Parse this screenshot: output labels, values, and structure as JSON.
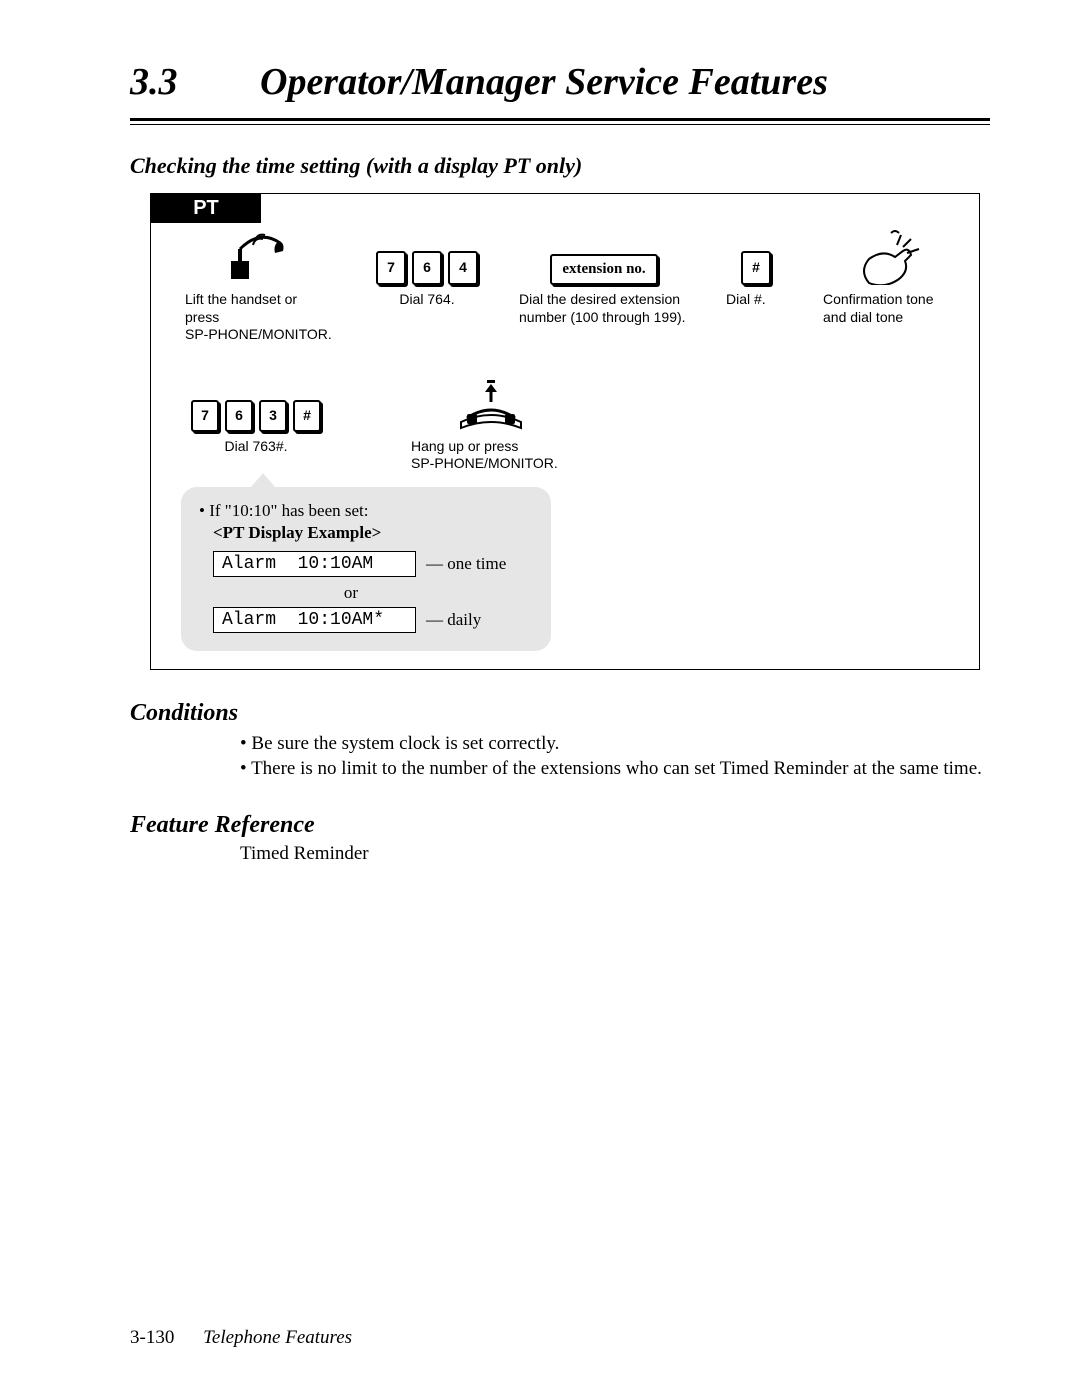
{
  "header": {
    "num": "3.3",
    "title": "Operator/Manager Service Features"
  },
  "subheading": "Checking the time setting (with a display PT only)",
  "pt_tab": "PT",
  "row1": {
    "step1": {
      "caption_l1": "Lift the handset or press",
      "caption_l2": "SP-PHONE/MONITOR."
    },
    "step2": {
      "k1": "7",
      "k2": "6",
      "k3": "4",
      "caption": "Dial 764."
    },
    "step3": {
      "box": "extension no.",
      "caption_l1": "Dial the desired extension",
      "caption_l2": "number (100 through 199)."
    },
    "step4": {
      "k": "#",
      "caption": "Dial #."
    },
    "step5": {
      "caption_l1": "Confirmation tone",
      "caption_l2": "and dial tone"
    }
  },
  "row2": {
    "step1": {
      "k1": "7",
      "k2": "6",
      "k3": "3",
      "k4": "#",
      "caption": "Dial 763#."
    },
    "step2": {
      "caption_l1": "Hang up or press",
      "caption_l2": "SP-PHONE/MONITOR."
    }
  },
  "bubble": {
    "line": "If \"10:10\" has been set:",
    "title": "<PT Display Example>",
    "disp1": "Alarm  10:10AM",
    "disp1_note": "— one time",
    "or": "or",
    "disp2": "Alarm  10:10AM*",
    "disp2_note": "— daily"
  },
  "conditions": {
    "heading": "Conditions",
    "items": [
      "Be sure the system clock is set correctly.",
      "There is no limit to the number of the extensions who can set Timed Reminder at the same time."
    ]
  },
  "feature_ref": {
    "heading": "Feature Reference",
    "text": "Timed Reminder"
  },
  "footer": {
    "page": "3-130",
    "label": "Telephone Features"
  }
}
